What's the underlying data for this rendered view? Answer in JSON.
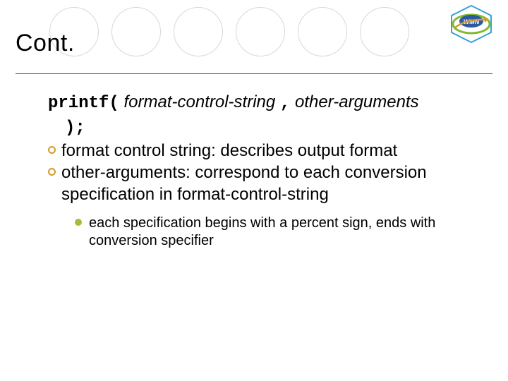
{
  "title": "Cont.",
  "logo": {
    "initials": "WMN"
  },
  "syntax": {
    "fn_open": "printf(",
    "arg1": "format-control-string",
    "comma": ",",
    "arg2": "other-arguments",
    "close": ");"
  },
  "bullets": [
    "format control string: describes output format",
    "other-arguments: correspond to each conversion specification in format-control-string"
  ],
  "subbullet": "each specification begins with a percent sign, ends with conversion specifier"
}
